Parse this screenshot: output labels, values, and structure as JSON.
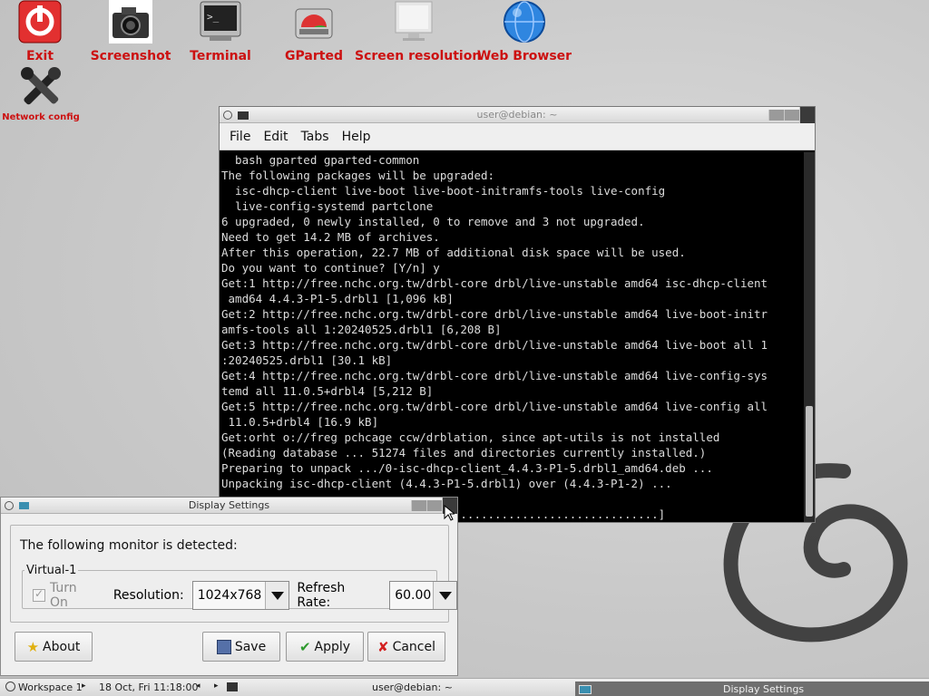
{
  "desktop": {
    "icons": [
      {
        "label": "Exit"
      },
      {
        "label": "Screenshot"
      },
      {
        "label": "Terminal"
      },
      {
        "label": "GParted"
      },
      {
        "label": "Screen resolution"
      },
      {
        "label": "Web Browser"
      },
      {
        "label": "Network config"
      }
    ]
  },
  "terminal": {
    "title": "user@debian: ~",
    "menu": [
      "File",
      "Edit",
      "Tabs",
      "Help"
    ],
    "lines": [
      "  bash gparted gparted-common",
      "The following packages will be upgraded:",
      "  isc-dhcp-client live-boot live-boot-initramfs-tools live-config",
      "  live-config-systemd partclone",
      "6 upgraded, 0 newly installed, 0 to remove and 3 not upgraded.",
      "Need to get 14.2 MB of archives.",
      "After this operation, 22.7 MB of additional disk space will be used.",
      "Do you want to continue? [Y/n] y",
      "Get:1 http://free.nchc.org.tw/drbl-core drbl/live-unstable amd64 isc-dhcp-client",
      " amd64 4.4.3-P1-5.drbl1 [1,096 kB]",
      "Get:2 http://free.nchc.org.tw/drbl-core drbl/live-unstable amd64 live-boot-initr",
      "amfs-tools all 1:20240525.drbl1 [6,208 B]",
      "Get:3 http://free.nchc.org.tw/drbl-core drbl/live-unstable amd64 live-boot all 1",
      ":20240525.drbl1 [30.1 kB]",
      "Get:4 http://free.nchc.org.tw/drbl-core drbl/live-unstable amd64 live-config-sys",
      "temd all 11.0.5+drbl4 [5,212 B]",
      "Get:5 http://free.nchc.org.tw/drbl-core drbl/live-unstable amd64 live-config all",
      " 11.0.5+drbl4 [16.9 kB]",
      "Get:orht o://freg pchcage ccw/drblation, since apt-utils is not installed",
      "(Reading database ... 51274 files and directories currently installed.)",
      "Preparing to unpack .../0-isc-dhcp-client_4.4.3-P1-5.drbl1_amd64.deb ...",
      "Unpacking isc-dhcp-client (4.4.3-P1-5.drbl1) over (4.4.3-P1-2) ...",
      "",
      "                     ...........................................]"
    ]
  },
  "dialog": {
    "title": "Display Settings",
    "detected_text": "The following monitor is detected:",
    "monitor_name": "Virtual-1",
    "turn_on_label": "Turn On",
    "resolution_label": "Resolution:",
    "resolution_value": "1024x768",
    "refresh_label": "Refresh Rate:",
    "refresh_value": "60.00",
    "buttons": {
      "about": "About",
      "save": "Save",
      "apply": "Apply",
      "cancel": "Cancel"
    }
  },
  "taskbar": {
    "workspace": "Workspace 1",
    "datetime": "18 Oct, Fri 11:18:00",
    "task_terminal": "user@debian: ~",
    "task_dialog": "Display Settings"
  },
  "colors": {
    "icon_label": "#cc1111",
    "terminal_bg": "#000000",
    "terminal_fg": "#dcdcdc"
  }
}
